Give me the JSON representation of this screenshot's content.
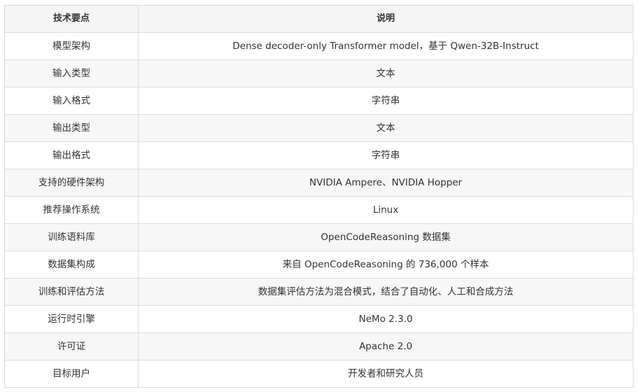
{
  "table": {
    "headers": [
      "技术要点",
      "说明"
    ],
    "rows": [
      [
        "模型架构",
        "Dense decoder-only Transformer model，基于 Qwen-32B-Instruct"
      ],
      [
        "输入类型",
        "文本"
      ],
      [
        "输入格式",
        "字符串"
      ],
      [
        "输出类型",
        "文本"
      ],
      [
        "输出格式",
        "字符串"
      ],
      [
        "支持的硬件架构",
        "NVIDIA Ampere、NVIDIA Hopper"
      ],
      [
        "推荐操作系统",
        "Linux"
      ],
      [
        "训练语料库",
        "OpenCodeReasoning 数据集"
      ],
      [
        "数据集构成",
        "来自 OpenCodeReasoning 的 736,000 个样本"
      ],
      [
        "训练和评估方法",
        "数据集评估方法为混合模式，结合了自动化、人工和合成方法"
      ],
      [
        "运行时引擎",
        "NeMo 2.3.0"
      ],
      [
        "许可证",
        "Apache 2.0"
      ],
      [
        "目标用户",
        "开发者和研究人员"
      ]
    ]
  }
}
